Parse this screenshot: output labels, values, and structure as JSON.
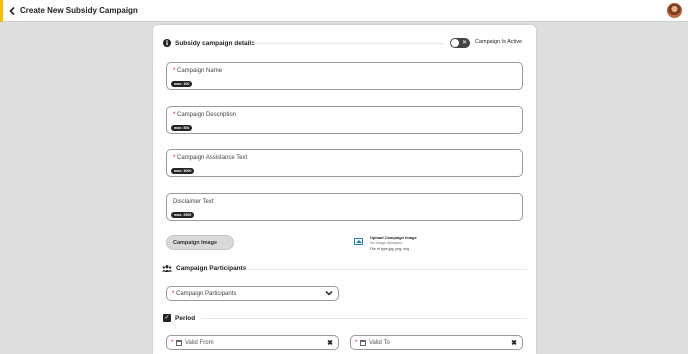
{
  "header": {
    "title": "Create New Subsidy Campaign",
    "back_icon": "chevron-left-icon",
    "accent_color": "#f2c200"
  },
  "details": {
    "title": "Subsidy campaign details",
    "toggle_label": "Campaign Is Active",
    "toggle_active": false
  },
  "fields": [
    {
      "label": "Campaign Name",
      "required": "*",
      "max": "max: 100"
    },
    {
      "label": "Campaign Description",
      "required": "*",
      "max": "max: 500"
    },
    {
      "label": "Campaign Assistance Text",
      "required": "*",
      "max": "max: 3000"
    },
    {
      "label": "Disclaimer Text",
      "required": "",
      "max": "max: 2500"
    }
  ],
  "image": {
    "button_label": "Campaign Image",
    "upload_title": "Upload Campaign Image",
    "upload_status": "No Image Uploaded",
    "upload_types": "File of type jpg, png, svg"
  },
  "participants": {
    "title": "Campaign Participants",
    "placeholder": "Campaign Participants",
    "required": "*"
  },
  "period": {
    "title": "Period",
    "from_placeholder": "Valid From",
    "to_placeholder": "Valid To",
    "required": "*",
    "clear_glyph": "✖"
  }
}
